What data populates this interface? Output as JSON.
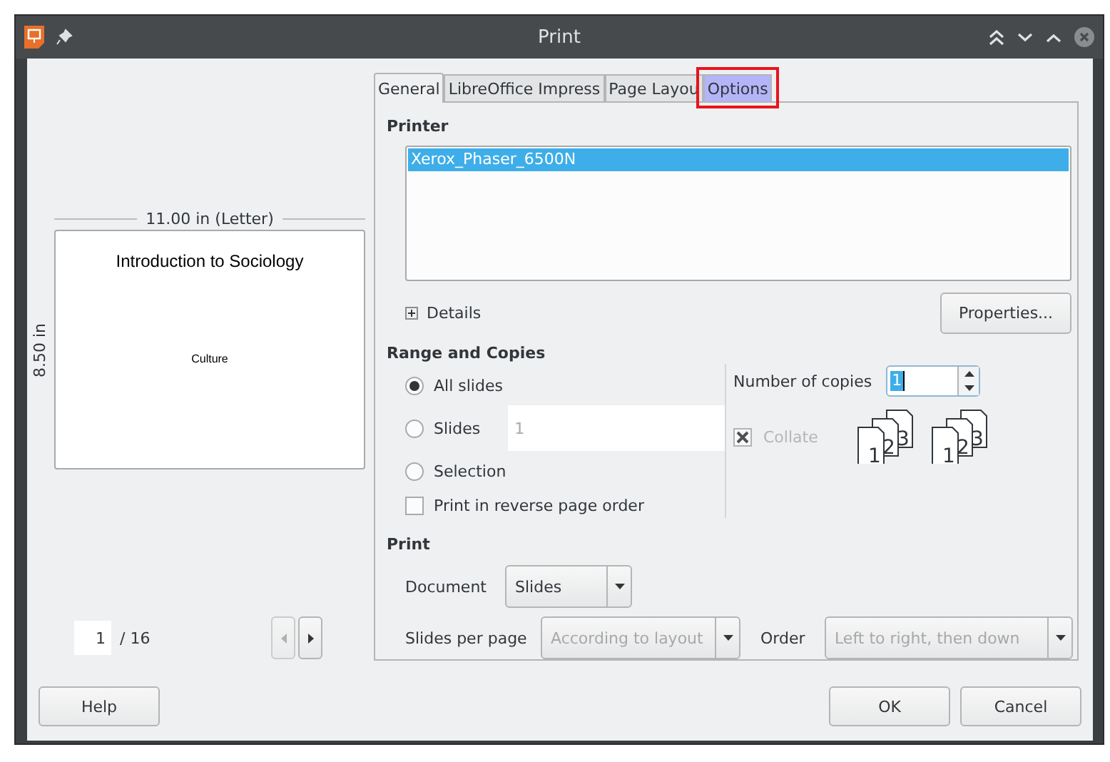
{
  "window": {
    "title": "Print"
  },
  "tabs": [
    {
      "label": "General",
      "selected": true,
      "highlighted": false
    },
    {
      "label": "LibreOffice Impress",
      "selected": false,
      "highlighted": false
    },
    {
      "label": "Page Layou",
      "selected": false,
      "highlighted": false
    },
    {
      "label": "Options",
      "selected": false,
      "highlighted": true
    }
  ],
  "preview": {
    "width_label": "11.00 in (Letter)",
    "height_label": "8.50 in",
    "slide_title": "Introduction to Sociology",
    "slide_subtitle": "Culture",
    "page": "1",
    "page_total": "/ 16"
  },
  "printer": {
    "heading": "Printer",
    "printers": [
      {
        "name": "Xerox_Phaser_6500N",
        "selected": true
      }
    ],
    "details": "Details",
    "properties": "Properties..."
  },
  "range": {
    "heading": "Range and Copies",
    "options": [
      {
        "label": "All slides",
        "selected": true
      },
      {
        "label": "Slides",
        "selected": false,
        "value": "1"
      },
      {
        "label": "Selection",
        "selected": false
      }
    ],
    "reverse": {
      "label": "Print in reverse page order",
      "checked": false
    },
    "copies_label": "Number of copies",
    "copies": "1",
    "collate": {
      "label": "Collate",
      "checked": true,
      "disabled": true
    },
    "collate_icons": [
      {
        "pages": [
          "1",
          "2",
          "3"
        ]
      },
      {
        "pages": [
          "1",
          "2",
          "3"
        ]
      }
    ]
  },
  "print": {
    "heading": "Print",
    "document": {
      "label": "Document",
      "value": "Slides",
      "disabled": false
    },
    "slides_per_page": {
      "label": "Slides per page",
      "value": "According to layout",
      "disabled": true
    },
    "order": {
      "label": "Order",
      "value": "Left to right, then down",
      "disabled": true
    }
  },
  "buttons": [
    {
      "label": "Help"
    },
    {
      "label": "OK"
    },
    {
      "label": "Cancel"
    }
  ]
}
